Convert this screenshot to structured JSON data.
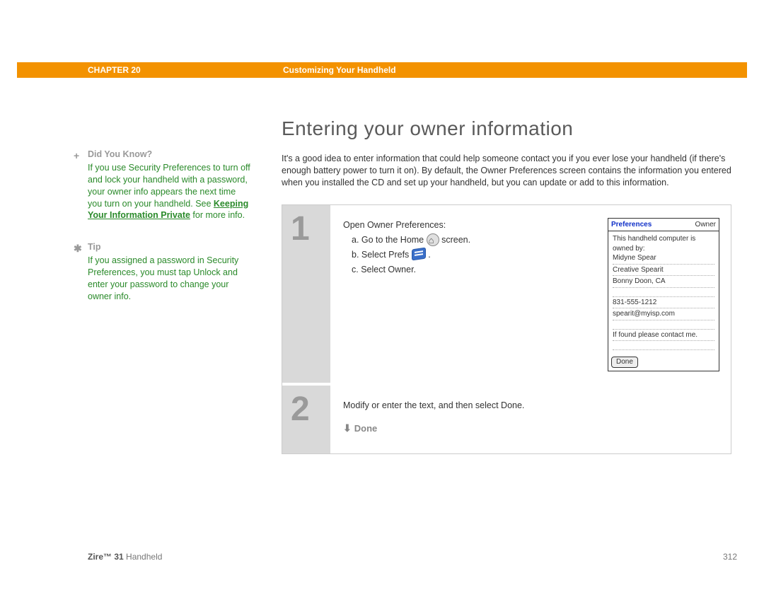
{
  "header": {
    "chapter": "CHAPTER 20",
    "title": "Customizing Your Handheld"
  },
  "sidebar": {
    "dyk": {
      "heading": "Did You Know?",
      "text_before": "If you use Security Preferences to turn off and lock your handheld with a password, your owner info appears the next time you turn on your handheld. See ",
      "link": "Keeping Your Information Private",
      "text_after": " for more info."
    },
    "tip": {
      "heading": "Tip",
      "text": "If you assigned a password in Security Preferences, you must tap Unlock and enter your password to change your owner info."
    }
  },
  "main": {
    "heading": "Entering your owner information",
    "intro": "It's a good idea to enter information that could help someone contact you if you ever lose your handheld (if there's enough battery power to turn it on). By default, the Owner Preferences screen contains the information you entered when you installed the CD and set up your handheld, but you can update or add to this information."
  },
  "steps": {
    "s1": {
      "num": "1",
      "lead": "Open Owner Preferences:",
      "a_pre": "a.  Go to the Home ",
      "a_post": " screen.",
      "b_pre": "b.  Select Prefs ",
      "b_post": " .",
      "c": "c.  Select Owner."
    },
    "s2": {
      "num": "2",
      "text": "Modify or enter the text, and then select Done.",
      "done": "Done"
    }
  },
  "device": {
    "title_left": "Preferences",
    "title_right": "Owner",
    "owned_by": "This handheld computer is owned by:",
    "l1": "Midyne Spear",
    "l2": "Creative Spearit",
    "l3": "Bonny Doon, CA",
    "l4": "831-555-1212",
    "l5": "spearit@myisp.com",
    "l6": "If found please contact me.",
    "btn": "Done"
  },
  "footer": {
    "product_bold": "Zire™ 31",
    "product_rest": " Handheld",
    "page": "312"
  }
}
